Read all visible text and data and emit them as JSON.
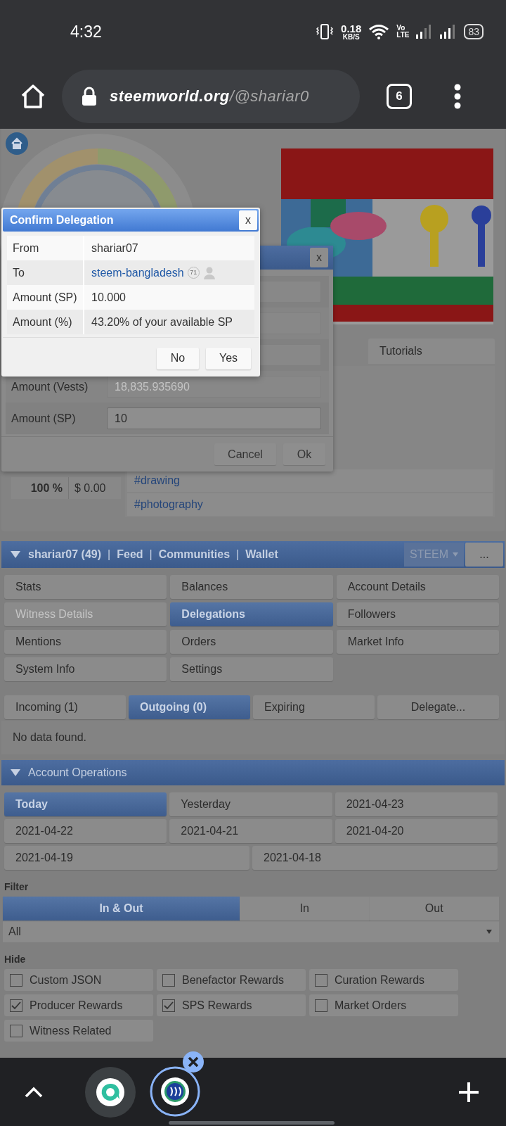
{
  "status_bar": {
    "time": "4:32",
    "net_speed": {
      "value": "0.18",
      "unit": "KB/S"
    },
    "volte": {
      "top": "Vo",
      "bottom": "LTE"
    },
    "battery": "83"
  },
  "browser": {
    "domain": "steemworld.org",
    "path": "/@shariar0",
    "tab_count": "6"
  },
  "header": {
    "tabs": [
      {
        "label": "Tutorials"
      }
    ],
    "tags": [
      "#drawing",
      "#photography"
    ],
    "vote_values": [
      {
        "percent": "100 %",
        "value": "$ 0.00"
      }
    ]
  },
  "account_bar": {
    "nav": [
      {
        "kind": "link",
        "text": "shariar07 (49)"
      },
      {
        "kind": "separator",
        "text": "|"
      },
      {
        "kind": "link",
        "text": "Feed"
      },
      {
        "kind": "separator",
        "text": "|"
      },
      {
        "kind": "link",
        "text": "Communities"
      },
      {
        "kind": "separator",
        "text": "|"
      },
      {
        "kind": "link",
        "text": "Wallet"
      }
    ],
    "currency": "STEEM",
    "more": "..."
  },
  "menu": [
    {
      "label": "Stats",
      "selected": false,
      "disabled": false
    },
    {
      "label": "Balances",
      "selected": false,
      "disabled": false
    },
    {
      "label": "Account Details",
      "selected": false,
      "disabled": false
    },
    {
      "label": "Witness Details",
      "selected": false,
      "disabled": true
    },
    {
      "label": "Delegations",
      "selected": true,
      "disabled": false
    },
    {
      "label": "Followers",
      "selected": false,
      "disabled": false
    },
    {
      "label": "Mentions",
      "selected": false,
      "disabled": false
    },
    {
      "label": "Orders",
      "selected": false,
      "disabled": false
    },
    {
      "label": "Market Info",
      "selected": false,
      "disabled": false
    },
    {
      "label": "System Info",
      "selected": false,
      "disabled": false
    },
    {
      "label": "Settings",
      "selected": false,
      "disabled": false
    }
  ],
  "delegation_tabs": [
    {
      "label": "Incoming (1)",
      "selected": false
    },
    {
      "label": "Outgoing (0)",
      "selected": true
    },
    {
      "label": "Expiring",
      "selected": false
    },
    {
      "label": "Delegate...",
      "selected": false
    }
  ],
  "message": "No data found.",
  "operations": {
    "title": "Account Operations",
    "days": [
      {
        "label": "Today",
        "selected": true
      },
      {
        "label": "Yesterday",
        "selected": false
      },
      {
        "label": "2021-04-23",
        "selected": false
      },
      {
        "label": "2021-04-22",
        "selected": false
      },
      {
        "label": "2021-04-21",
        "selected": false
      },
      {
        "label": "2021-04-20",
        "selected": false
      },
      {
        "label": "2021-04-19",
        "selected": false
      },
      {
        "label": "2021-04-18",
        "selected": false
      }
    ],
    "filter": {
      "label": "Filter",
      "options": [
        {
          "label": "In & Out",
          "selected": true
        },
        {
          "label": "In",
          "selected": false
        },
        {
          "label": "Out",
          "selected": false
        }
      ]
    },
    "type_select": {
      "value": "All"
    },
    "hide": {
      "label": "Hide",
      "options": [
        {
          "label": "Custom JSON",
          "checked": false
        },
        {
          "label": "Benefactor Rewards",
          "checked": false
        },
        {
          "label": "Curation Rewards",
          "checked": false
        },
        {
          "label": "Producer Rewards",
          "checked": true
        },
        {
          "label": "SPS Rewards",
          "checked": true
        },
        {
          "label": "Market Orders",
          "checked": false
        },
        {
          "label": "Witness Related",
          "checked": false
        }
      ]
    }
  },
  "delegate_dialog": {
    "close": "x",
    "rows": [
      {
        "label": "Amount (Vests)",
        "value": "18,835.935690",
        "disabled": true
      },
      {
        "label": "Amount (SP)",
        "value": "10",
        "disabled": false
      }
    ],
    "buttons": [
      "Cancel",
      "Ok"
    ]
  },
  "confirm_dialog": {
    "title": "Confirm Delegation",
    "close": "x",
    "rows": [
      {
        "kind": "text",
        "label": "From",
        "value": "shariar07"
      },
      {
        "kind": "account",
        "label": "To",
        "value": "steem-bangladesh",
        "reputation": "71"
      },
      {
        "kind": "text",
        "label": "Amount (SP)",
        "value": "10.000"
      },
      {
        "kind": "text",
        "label": "Amount (%)",
        "value": "43.20% of your available SP"
      }
    ],
    "buttons": [
      "No",
      "Yes"
    ]
  }
}
